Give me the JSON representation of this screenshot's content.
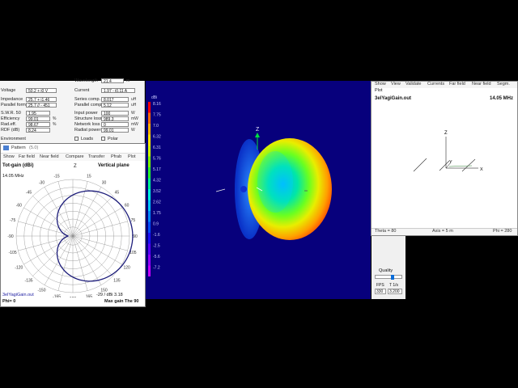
{
  "top_panel": {
    "header_label": "Wavelength",
    "header_value": "21.4",
    "header_unit": "m",
    "voltage_label": "Voltage",
    "voltage_value": "50.2 + j0 V",
    "current_label": "Current",
    "current_value": "1.97 - j0.11 A",
    "impedance_label": "Impedance",
    "impedance_value": "25.7 + j1.46",
    "parallel_label": "Parallel form",
    "parallel_value": "25.7 // - 451",
    "swr_label": "S.W.R. 50",
    "swr_value": "1.95",
    "efficiency_label": "Efficiency",
    "efficiency_value": "99.01",
    "efficiency_unit": "%",
    "radeff_label": "Rad.eff.",
    "radeff_value": "98.67",
    "radeff_unit": "%",
    "rdf_label": "RDF (dB)",
    "rdf_value": "8.24",
    "environment_label": "Environment",
    "series_comp_label": "Series comp.",
    "series_comp_value": "8.017",
    "series_comp_unit": "uH",
    "parallel_comp_label": "Parallel comp.",
    "parallel_comp_value": "5.12",
    "parallel_comp_unit": "uH",
    "input_power_label": "Input power",
    "input_power_value": "100",
    "input_power_unit": "W",
    "structure_loss_label": "Structure loss",
    "structure_loss_value": "989.3",
    "structure_loss_unit": "mW",
    "network_loss_label": "Network loss",
    "network_loss_value": "0",
    "network_loss_unit": "mW",
    "radiat_power_label": "Radiat power",
    "radiat_power_value": "99.01",
    "radiat_power_unit": "W",
    "loads_label": "Loads",
    "polar_label": "Polar"
  },
  "pattern_window": {
    "title": "Pattern",
    "title_suffix": "(5.0)",
    "menu": [
      "Show",
      "Far field",
      "Near field",
      "Compare",
      "Transfer",
      "Pfrab",
      "Plot"
    ],
    "tot_gain_label": "Tot-gain (dBi)",
    "plane_label": "Vertical plane",
    "frequency": "14.05 MHz",
    "z_label": "Z",
    "angle_labels": [
      "0",
      "15",
      "30",
      "45",
      "60",
      "75",
      "90",
      "105",
      "120",
      "135",
      "150",
      "165",
      "180",
      "-165",
      "-150",
      "-135",
      "-120",
      "-105",
      "-90",
      "-75",
      "-60",
      "-45",
      "-30",
      "-15"
    ],
    "file_name": "3elYagiGain.out",
    "phi_label": "Phi= 0",
    "gain_readout": "-29 / dBi 3.18",
    "max_gain_label": "Max gain The 90"
  },
  "view3d": {
    "z_axis_label": "Z",
    "scale_unit": "dBi",
    "scale_values": [
      "8.16",
      "7.75",
      "7.0",
      "6.32",
      "6.31",
      "5.76",
      "5.17",
      "4.32",
      "3.52",
      "2.62",
      "1.75",
      "0.9",
      "-1.6",
      "-2.5",
      "-5.6",
      "-7.2"
    ],
    "scale_colors": [
      "#ff0000",
      "#ff6a00",
      "#ffb300",
      "#ffe600",
      "#cfff00",
      "#7dff00",
      "#2aff2a",
      "#00ff90",
      "#00ffe0",
      "#00c8ff",
      "#008cff",
      "#0050ff",
      "#1a10ff",
      "#5a00ff",
      "#9600ff",
      "#c800ff"
    ]
  },
  "right_window": {
    "menu": [
      "Show",
      "View",
      "Validate",
      "Currents",
      "Far field",
      "Near field",
      "Segm."
    ],
    "sub_menu": "Plot",
    "file_name": "3elYagiGain.out",
    "frequency": "14.05 MHz",
    "z_label": "Z",
    "y_label": "Y",
    "x_label": "X",
    "status_theta": "Theta = 80",
    "status_axis": "Axis = 5 m",
    "status_phi": "Phi = 280"
  },
  "quality": {
    "title": "Quality",
    "fps_label": "FPS",
    "t_label": "T 1/s",
    "fps_value": "330",
    "t_value": "3.200"
  }
}
